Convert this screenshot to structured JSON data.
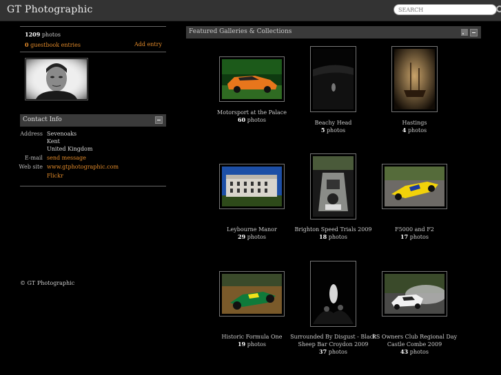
{
  "header": {
    "site_title": "GT Photographic",
    "search_placeholder": "SEARCH"
  },
  "sidebar": {
    "photo_count": "1209",
    "photo_label": "photos",
    "guestbook_count": "0",
    "guestbook_label": "guestbook entries",
    "add_entry": "Add entry",
    "contact_title": "Contact Info",
    "contact": {
      "address_label": "Address",
      "address_line1": "Sevenoaks",
      "address_line2": "Kent",
      "address_line3": "United Kingdom",
      "email_label": "E-mail",
      "email_value": "send message",
      "website_label": "Web site",
      "website_value": "www.gtphotographic.com",
      "flickr": "Flickr"
    },
    "copyright": "© GT Photographic"
  },
  "main": {
    "title": "Featured Galleries & Collections",
    "galleries": [
      {
        "name": "Motorsport at the Palace",
        "count": "60",
        "unit": "photos"
      },
      {
        "name": "Beachy Head",
        "count": "5",
        "unit": "photos"
      },
      {
        "name": "Hastings",
        "count": "4",
        "unit": "photos"
      },
      {
        "name": "Leybourne Manor",
        "count": "29",
        "unit": "photos"
      },
      {
        "name": "Brighton Speed Trials 2009",
        "count": "18",
        "unit": "photos"
      },
      {
        "name": "F5000 and F2",
        "count": "17",
        "unit": "photos"
      },
      {
        "name": "Historic Formula One",
        "count": "19",
        "unit": "photos"
      },
      {
        "name": "Surrounded By Disgust - Black Sheep Bar Croydon 2009",
        "count": "37",
        "unit": "photos"
      },
      {
        "name": "RS Owners Club Regional Day Castle Combe 2009",
        "count": "43",
        "unit": "photos"
      }
    ]
  },
  "colors": {
    "accent": "#e38b2a",
    "header_bg": "#333333",
    "panel_bg": "#3a3a3a",
    "page_bg": "#000000"
  }
}
